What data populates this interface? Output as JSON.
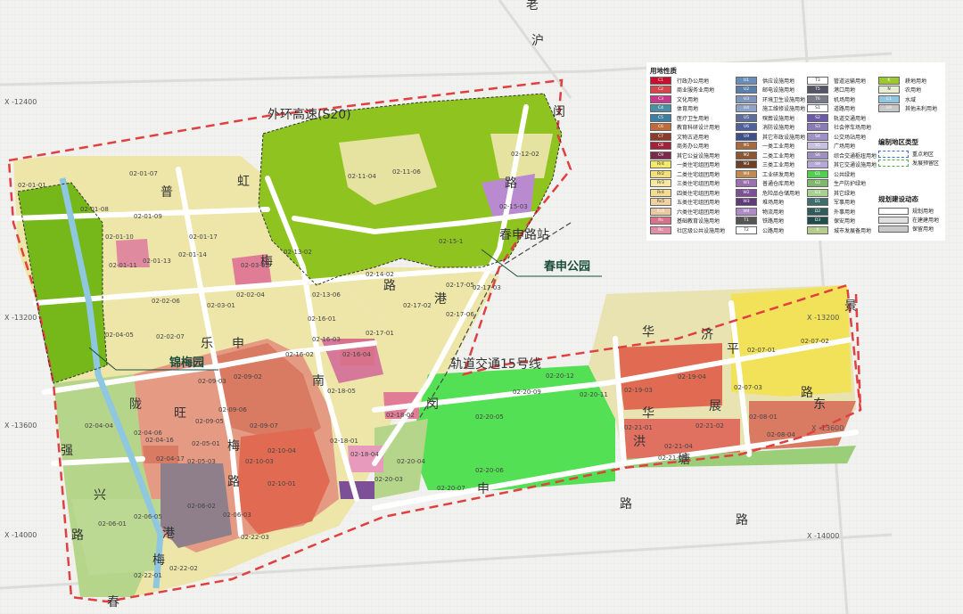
{
  "map": {
    "roads": {
      "s20": "外环高速(S20)",
      "metro": "轨道交通15号线",
      "station": "春申路站",
      "hongmei": [
        "虹",
        "梅",
        "路"
      ],
      "lao_hu_min": [
        "老",
        "沪",
        "闵",
        "路"
      ],
      "pule": [
        "普",
        "乐",
        "路"
      ],
      "shen": [
        "申",
        "南",
        "路"
      ],
      "meiluo": [
        "梅",
        "港",
        "路"
      ],
      "hua": [
        "华",
        "路"
      ],
      "huaxiang": [
        "华",
        "洪",
        "塘"
      ],
      "pingzhan": [
        "济",
        "平",
        "展",
        "路"
      ],
      "dong": [
        "景",
        "东"
      ],
      "chun": [
        "春"
      ],
      "ling": [
        "陇",
        "旺"
      ],
      "xing": [
        "强",
        "兴",
        "路"
      ],
      "huaishen": [
        "路",
        "申"
      ]
    },
    "parks": {
      "chunshen": "春申公园",
      "jinmei": "锦梅园"
    },
    "coords": {
      "x12400": "X -12400",
      "x13200": "X -13200",
      "x13600": "X -13600",
      "x14000": "X -14000",
      "x13200r": "X -13200",
      "x13600r": "X -13600",
      "x14000r": "X -14000"
    },
    "parcels": [
      "02-01-01",
      "02-01-07",
      "02-01-08",
      "02-01-09",
      "02-01-17",
      "02-01-10",
      "02-01-11",
      "02-01-13",
      "02-01-14",
      "02-02-06",
      "02-02-04",
      "02-03-01",
      "02-03-02",
      "02-04-05",
      "02-02-07",
      "02-11-04",
      "02-11-06",
      "02-12-02",
      "02-13-02",
      "02-14-02",
      "02-13-06",
      "02-15-03",
      "02-15-1",
      "02-17-05",
      "02-17-03",
      "02-17-02",
      "02-17-06",
      "02-16-01",
      "02-16-03",
      "02-16-02",
      "02-16-04",
      "02-17-01",
      "02-18-05",
      "02-18-01",
      "02-18-04",
      "02-18-02",
      "02-20-09",
      "02-20-05",
      "02-20-12",
      "02-20-11",
      "02-20-04",
      "02-20-03",
      "02-20-06",
      "02-20-07",
      "02-19-03",
      "02-19-04",
      "02-07-01",
      "02-07-02",
      "02-07-03",
      "02-08-01",
      "02-08-04",
      "02-21-04",
      "02-21-05",
      "02-21-01",
      "02-21-02",
      "02-09-02",
      "02-09-03",
      "02-09-06",
      "02-09-07",
      "02-09-05",
      "02-10-04",
      "02-10-01",
      "02-10-03",
      "02-04-04",
      "02-04-06",
      "02-04-16",
      "02-04-17",
      "02-05-01",
      "02-05-03",
      "02-06-01",
      "02-06-02",
      "02-06-05",
      "02-06-03",
      "02-22-03",
      "02-22-02",
      "02-22-01"
    ]
  },
  "legend": {
    "title_landuse": "用地性质",
    "title_types": "编制地区类型",
    "title_plan": "规划建设动态",
    "col1": [
      {
        "code": "C1",
        "label": "行政办公用地",
        "color": "#c8102e"
      },
      {
        "code": "C2",
        "label": "商业服务业用地",
        "color": "#d9434b"
      },
      {
        "code": "C3",
        "label": "文化用地",
        "color": "#c7398a"
      },
      {
        "code": "C4",
        "label": "体育用地",
        "color": "#4c8fa3"
      },
      {
        "code": "C5",
        "label": "医疗卫生用地",
        "color": "#3e7ea0"
      },
      {
        "code": "C6",
        "label": "教育科研设计用地",
        "color": "#c16a3a"
      },
      {
        "code": "C7",
        "label": "文物古迹用地",
        "color": "#8b3c2b"
      },
      {
        "code": "C8",
        "label": "商务办公用地",
        "color": "#a2223a"
      },
      {
        "code": "C9",
        "label": "其它公益设施用地",
        "color": "#7c2a4a"
      },
      {
        "code": "Rr4",
        "label": "一类住宅组团用地",
        "color": "#f5e96a"
      },
      {
        "code": "Rr2",
        "label": "二类住宅组团用地",
        "color": "#f3e07a"
      },
      {
        "code": "Rr3",
        "label": "三类住宅组团用地",
        "color": "#f7e9a2"
      },
      {
        "code": "Rr4",
        "label": "四类住宅组团用地",
        "color": "#f4dd93"
      },
      {
        "code": "Rc5",
        "label": "五类住宅组团用地",
        "color": "#f1d3a0"
      },
      {
        "code": "Rc6",
        "label": "六类住宅组团用地",
        "color": "#eac8a1"
      },
      {
        "code": "Rs",
        "label": "基础教育设施用地",
        "color": "#d7728a"
      },
      {
        "code": "Rc",
        "label": "社区级公共设施用地",
        "color": "#e28fa5"
      }
    ],
    "col2": [
      {
        "code": "U1",
        "label": "供应设施用地",
        "color": "#6b8eb8"
      },
      {
        "code": "U2",
        "label": "邮电设施用地",
        "color": "#5a7fac"
      },
      {
        "code": "U3",
        "label": "环境卫生设施用地",
        "color": "#7f95bc"
      },
      {
        "code": "U4",
        "label": "施工维修设施用地",
        "color": "#8fa3c6"
      },
      {
        "code": "U5",
        "label": "殡葬设施用地",
        "color": "#5b6f9a"
      },
      {
        "code": "U6",
        "label": "消防设施用地",
        "color": "#4e62a0"
      },
      {
        "code": "U9",
        "label": "其它市政设施用地",
        "color": "#3e4f8a"
      },
      {
        "code": "M1",
        "label": "一类工业用地",
        "color": "#a56b40"
      },
      {
        "code": "M2",
        "label": "二类工业用地",
        "color": "#8c5533"
      },
      {
        "code": "M3",
        "label": "三类工业用地",
        "color": "#6e4127"
      },
      {
        "code": "M4",
        "label": "工业研发用地",
        "color": "#c08a50"
      },
      {
        "code": "W1",
        "label": "普通仓库用地",
        "color": "#9c6fb0"
      },
      {
        "code": "W2",
        "label": "危险品仓储用地",
        "color": "#7c4f96"
      },
      {
        "code": "W3",
        "label": "堆场用地",
        "color": "#5f3b7c"
      },
      {
        "code": "W4",
        "label": "物流用地",
        "color": "#b08ac6"
      },
      {
        "code": "T1",
        "label": "铁路用地",
        "color": "#555555"
      },
      {
        "code": "T2",
        "label": "公路用地",
        "color": "#ffffff"
      }
    ],
    "col3": [
      {
        "code": "T3",
        "label": "管道运输用地",
        "color": "#ffffff"
      },
      {
        "code": "T5",
        "label": "港口用地",
        "color": "#555566"
      },
      {
        "code": "T6",
        "label": "机场用地",
        "color": "#7a7a88"
      },
      {
        "code": "S1",
        "label": "道路用地",
        "color": "#ffffff"
      },
      {
        "code": "S2",
        "label": "轨道交通用地",
        "color": "#6a5aa8"
      },
      {
        "code": "S3",
        "label": "社会停车场用地",
        "color": "#8a7ab8"
      },
      {
        "code": "S4",
        "label": "公交场站用地",
        "color": "#a090c8"
      },
      {
        "code": "S5",
        "label": "广场用地",
        "color": "#c8c0e0"
      },
      {
        "code": "S6",
        "label": "综合交通枢纽用地",
        "color": "#9f8fc0"
      },
      {
        "code": "S9",
        "label": "其它交通设施用地",
        "color": "#b7a8d8"
      },
      {
        "code": "G1",
        "label": "公共绿地",
        "color": "#4fd14f"
      },
      {
        "code": "G2",
        "label": "生产防护绿地",
        "color": "#7fb86a"
      },
      {
        "code": "G3",
        "label": "其它绿地",
        "color": "#a8d08f"
      },
      {
        "code": "D1",
        "label": "军事用地",
        "color": "#3d6e6a"
      },
      {
        "code": "D2",
        "label": "外事用地",
        "color": "#2f5e5a"
      },
      {
        "code": "D3",
        "label": "保安用地",
        "color": "#1f4e4a"
      },
      {
        "code": "X",
        "label": "城市发展备用地",
        "color": "#b5cc8a"
      }
    ],
    "col4": [
      {
        "code": "K",
        "label": "耕地用地",
        "color": "#9ec92e"
      },
      {
        "code": "N",
        "label": "农用地",
        "color": "#e8efd0"
      },
      {
        "code": "E1",
        "label": "水域",
        "color": "#8fc6e0"
      },
      {
        "code": "E9",
        "label": "其他未利用地",
        "color": "#c8c8c8"
      }
    ],
    "types": [
      {
        "label": "重点地区"
      },
      {
        "label": "发展预留区"
      }
    ],
    "plan": [
      {
        "label": "规划用地",
        "color": "#ffffff"
      },
      {
        "label": "在建建用地",
        "color": "#e0e0e0"
      },
      {
        "label": "保留用地",
        "color": "#c8c8c8"
      }
    ]
  }
}
